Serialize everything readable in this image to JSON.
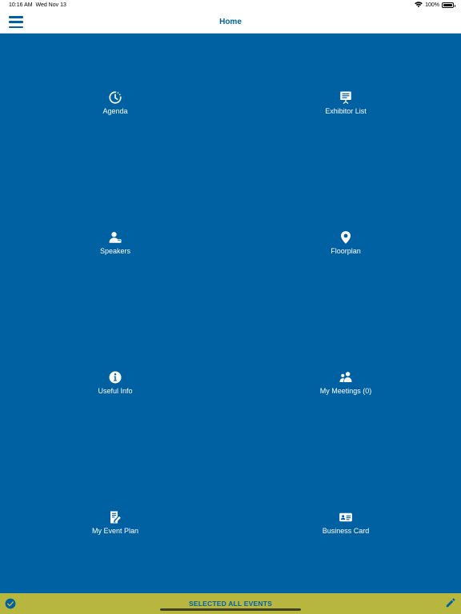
{
  "status_bar": {
    "time": "10:16 AM",
    "date": "Wed Nov 13",
    "battery": "100%",
    "battery_level": 1.0
  },
  "nav": {
    "title": "Home",
    "menu_icon": "hamburger-menu-icon"
  },
  "tiles": [
    {
      "label": "Agenda",
      "icon": "clock-icon"
    },
    {
      "label": "Exhibitor List",
      "icon": "presentation-board-icon"
    },
    {
      "label": "Speakers",
      "icon": "speaker-person-icon"
    },
    {
      "label": "Floorplan",
      "icon": "map-pin-icon"
    },
    {
      "label": "Useful Info",
      "icon": "info-icon"
    },
    {
      "label": "My Meetings (0)",
      "icon": "people-icon"
    },
    {
      "label": "My Event Plan",
      "icon": "document-edit-icon"
    },
    {
      "label": "Business Card",
      "icon": "id-card-icon"
    }
  ],
  "bottom_bar": {
    "label": "SELECTED ALL EVENTS",
    "left_icon": "checkmark-circle-icon",
    "right_icon": "pencil-icon"
  },
  "colors": {
    "primary": "#0061a2",
    "bottom_bar": "#b7b740",
    "white": "#ffffff"
  }
}
